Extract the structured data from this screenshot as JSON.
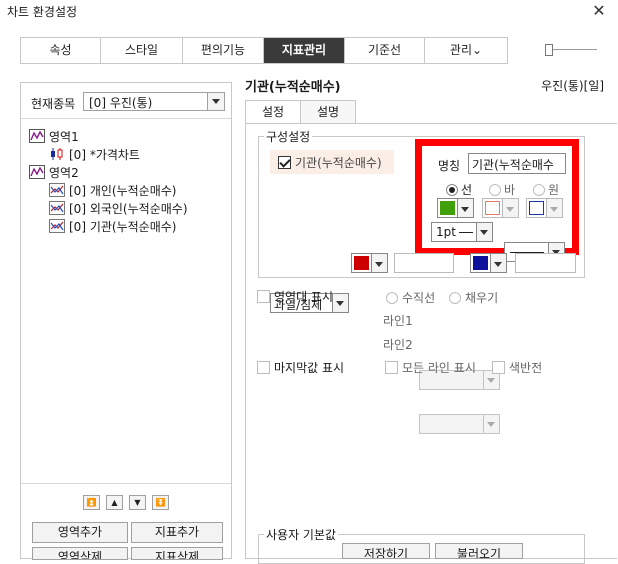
{
  "window": {
    "title": "차트 환경설정"
  },
  "top_tabs": [
    {
      "label": "속성"
    },
    {
      "label": "스타일"
    },
    {
      "label": "편의기능"
    },
    {
      "label": "지표관리"
    },
    {
      "label": "기준선"
    },
    {
      "label": "관리⌄"
    }
  ],
  "left": {
    "stock_label": "현재종목",
    "stock_value": "[0] 우진(통)",
    "tree": {
      "area1": "영역1",
      "price_chart": "[0] *가격차트",
      "area2": "영역2",
      "indiv": "[0] 개인(누적순매수)",
      "foreign": "[0] 외국인(누적순매수)",
      "inst": "[0] 기관(누적순매수)"
    },
    "buttons": {
      "add_area": "영역추가",
      "add_indicator": "지표추가",
      "delete_area": "영역삭제",
      "delete_indicator": "지표삭제"
    }
  },
  "right": {
    "title": "기관(누적순매수)",
    "stock": "우진(통)[일]",
    "subtabs": {
      "settings": "설정",
      "desc": "설명"
    },
    "config_label": "구성설정",
    "item_label": "기관(누적순매수)",
    "name_label": "명칭",
    "name_value": "기관(누적순매수",
    "radio_line": "선",
    "radio_bar": "바",
    "radio_circle": "원",
    "line_width": "1pt",
    "overheat_label": "과열/침체",
    "area_band": "영역대 표시",
    "vertical_line": "수직선",
    "fill": "채우기",
    "line1": "라인1",
    "line2": "라인2",
    "last_value": "마지막값 표시",
    "all_lines": "모든 라인 표시",
    "invert": "색반전",
    "user_default": "사용자 기본값",
    "save": "저장하기",
    "load": "불러오기"
  },
  "colors": {
    "line_color": "#3fa00a",
    "bar_color": "#e87a6a",
    "circle_color": "#1a3aa0",
    "overheat_color": "#cc0000",
    "oversold_color": "#0d119c",
    "highlight": "#ff0000",
    "active_tab": "#3a3a3a"
  }
}
